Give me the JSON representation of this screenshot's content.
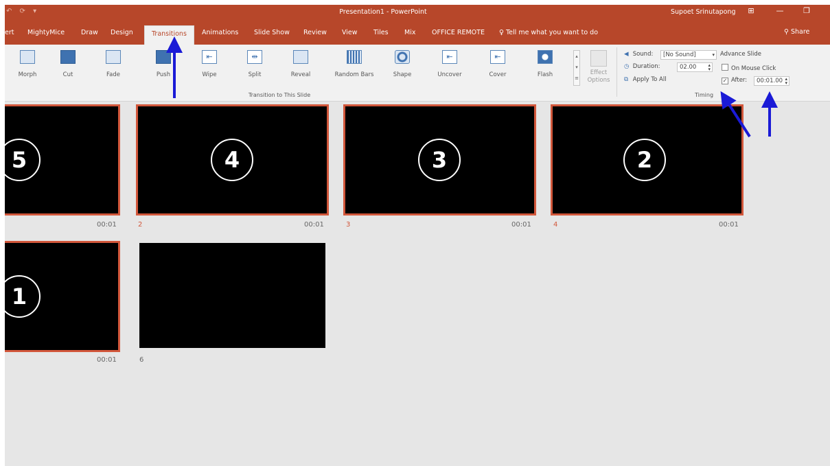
{
  "title_bar": {
    "quick_access": "↶ ⟳ ▾",
    "app_title": "Presentation1 - PowerPoint",
    "user": "Supoet Srinutapong",
    "controls": {
      "display_options": "⊞",
      "minimize": "—",
      "restore": "❐"
    }
  },
  "tabs": [
    {
      "label": "ert"
    },
    {
      "label": "MightyMice"
    },
    {
      "label": "Draw"
    },
    {
      "label": "Design"
    },
    {
      "label": "Transitions"
    },
    {
      "label": "Animations"
    },
    {
      "label": "Slide Show"
    },
    {
      "label": "Review"
    },
    {
      "label": "View"
    },
    {
      "label": "Tiles"
    },
    {
      "label": "Mix"
    },
    {
      "label": "OFFICE REMOTE"
    }
  ],
  "active_tab": "Transitions",
  "tell_me": "Tell me what you want to do",
  "share": "Share",
  "ribbon": {
    "transitions": [
      {
        "label": "Morph",
        "icon": "morph-icon"
      },
      {
        "label": "Cut",
        "icon": "cut-icon"
      },
      {
        "label": "Fade",
        "icon": "fade-icon"
      },
      {
        "label": "Push",
        "icon": "push-icon"
      },
      {
        "label": "Wipe",
        "icon": "wipe-icon"
      },
      {
        "label": "Split",
        "icon": "split-icon"
      },
      {
        "label": "Reveal",
        "icon": "reveal-icon"
      },
      {
        "label": "Random Bars",
        "icon": "random-bars-icon"
      },
      {
        "label": "Shape",
        "icon": "shape-icon"
      },
      {
        "label": "Uncover",
        "icon": "uncover-icon"
      },
      {
        "label": "Cover",
        "icon": "cover-icon"
      },
      {
        "label": "Flash",
        "icon": "flash-icon"
      }
    ],
    "effect_options": "Effect Options",
    "transition_group_label": "Transition to This Slide",
    "timing": {
      "sound_label": "Sound:",
      "sound_value": "[No Sound]",
      "duration_label": "Duration:",
      "duration_value": "02.00",
      "apply_to_all": "Apply To All",
      "advance_slide": "Advance Slide",
      "on_mouse_click": "On Mouse Click",
      "on_mouse_click_checked": false,
      "after_label": "After:",
      "after_checked": true,
      "after_value": "00:01.00",
      "group_label": "Timing"
    }
  },
  "slides": [
    {
      "index": "",
      "circle": "5",
      "time": "00:01",
      "selected": true
    },
    {
      "index": "2",
      "circle": "4",
      "time": "00:01",
      "selected": true
    },
    {
      "index": "3",
      "circle": "3",
      "time": "00:01",
      "selected": true
    },
    {
      "index": "4",
      "circle": "2",
      "time": "00:01",
      "selected": true
    },
    {
      "index": "",
      "circle": "1",
      "time": "00:01",
      "selected": true
    },
    {
      "index": "6",
      "circle": "",
      "time": "",
      "selected": false
    }
  ],
  "colors": {
    "accent": "#b7472a",
    "selection": "#d2573b",
    "annotation": "#1a1ad6"
  }
}
